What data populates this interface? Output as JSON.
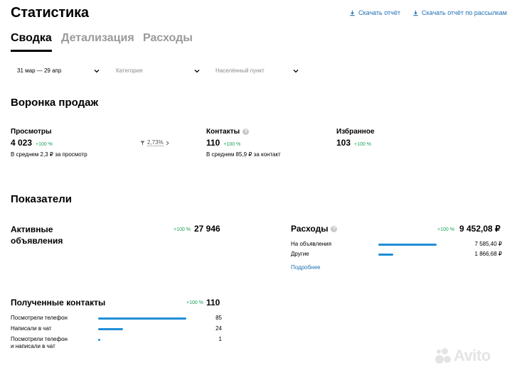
{
  "page": {
    "title": "Статистика",
    "download_report": "Скачать отчёт",
    "download_mailing": "Скачать отчёт по рассылкам"
  },
  "tabs": [
    {
      "label": "Сводка",
      "active": true
    },
    {
      "label": "Детализация",
      "active": false
    },
    {
      "label": "Расходы",
      "active": false
    }
  ],
  "filters": {
    "date": "31 мар — 29 апр",
    "category_placeholder": "Категория",
    "location_placeholder": "Населённый пункт"
  },
  "funnel": {
    "title": "Воронка продаж",
    "views": {
      "label": "Просмотры",
      "value": "4 023",
      "change": "+100 %",
      "note": "В среднем 2,3 ₽ за просмотр"
    },
    "conversion": "2,73%",
    "contacts": {
      "label": "Контакты",
      "value": "110",
      "change": "+100 %",
      "note": "В среднем 85,9 ₽ за контакт"
    },
    "favorites": {
      "label": "Избранное",
      "value": "103",
      "change": "+100 %"
    }
  },
  "indicators": {
    "title": "Показатели",
    "active_ads": {
      "label_line1": "Активные",
      "label_line2": "объявления",
      "change": "+100 %",
      "value": "27 946"
    },
    "expenses": {
      "label": "Расходы",
      "change": "+100 %",
      "value": "9 452,08 ₽",
      "rows": [
        {
          "label": "На объявления",
          "value": "7 585,40 ₽",
          "share": 0.8
        },
        {
          "label": "Другие",
          "value": "1 866,68 ₽",
          "share": 0.2
        }
      ],
      "more": "Подробнее"
    },
    "contacts": {
      "label": "Полученные контакты",
      "change": "+100 %",
      "value": "110",
      "rows": [
        {
          "label": "Посмотрели телефон",
          "value": "85",
          "share": 0.773
        },
        {
          "label": "Написали в чат",
          "value": "24",
          "share": 0.218
        },
        {
          "label_line1": "Посмотрели телефон",
          "label_line2": "и написали в чат",
          "value": "1",
          "share": 0.009
        }
      ]
    }
  },
  "brand": {
    "name": "Avito"
  },
  "colors": {
    "accent": "#1f8ed6",
    "positive": "#1aa25a",
    "link": "#1f6fb2"
  }
}
